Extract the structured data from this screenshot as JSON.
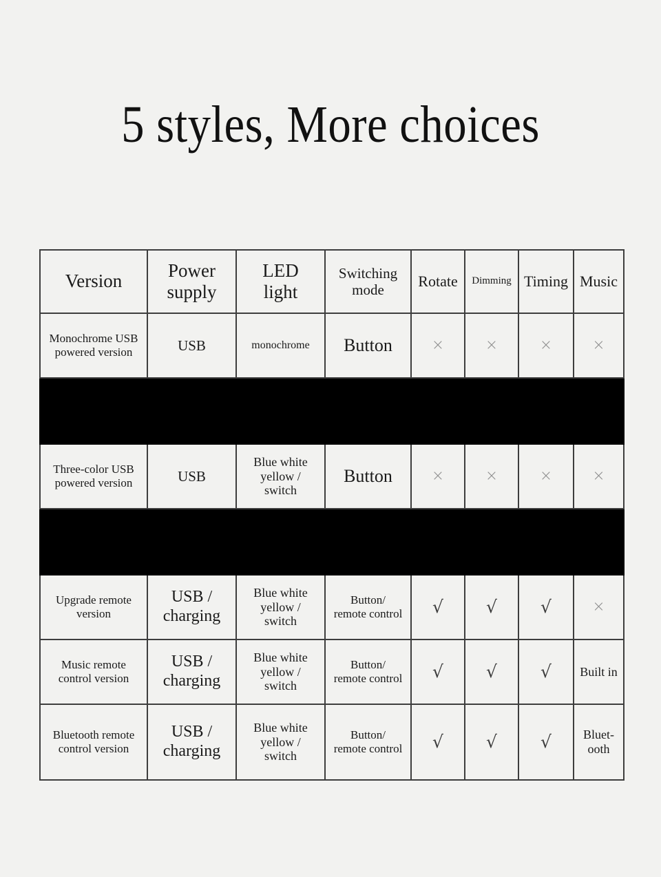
{
  "page": {
    "title": "5 styles, More choices",
    "background_color": "#f2f2f0",
    "text_color": "#1a1a1a",
    "border_color": "#3d3d3d",
    "band_color": "#000000",
    "x_mark_color": "#8e8e8e",
    "check_mark_color": "#3c3c3c"
  },
  "table": {
    "headers": [
      {
        "label": "Version"
      },
      {
        "label": "Power\nsupply"
      },
      {
        "label": "LED\nlight"
      },
      {
        "label": "Switching\nmode"
      },
      {
        "label": "Rotate"
      },
      {
        "label": "Dimming"
      },
      {
        "label": "Timing"
      },
      {
        "label": "Music"
      }
    ],
    "header_labels": {
      "version": "Version",
      "power_line1": "Power",
      "power_line2": "supply",
      "led_line1": "LED",
      "led_line2": "light",
      "switch_line1": "Switching",
      "switch_line2": "mode",
      "rotate": "Rotate",
      "dimming": "Dimming",
      "timing": "Timing",
      "music": "Music"
    },
    "rows": [
      {
        "type": "data",
        "version_line1": "Monochrome USB",
        "version_line2": "powered version",
        "power": "USB",
        "led_line1": "monochrome",
        "led_line2": "",
        "led_line3": "",
        "switch": "Button",
        "rotate": "×",
        "dimming": "×",
        "timing": "×",
        "music": "×"
      },
      {
        "type": "band"
      },
      {
        "type": "data",
        "version_line1": "Three-color USB",
        "version_line2": "powered version",
        "power": "USB",
        "led_line1": "Blue white",
        "led_line2": "yellow /",
        "led_line3": "switch",
        "switch": "Button",
        "rotate": "×",
        "dimming": "×",
        "timing": "×",
        "music": "×"
      },
      {
        "type": "band"
      },
      {
        "type": "data",
        "version_line1": "Upgrade remote",
        "version_line2": "version",
        "power_line1": "USB /",
        "power_line2": "charging",
        "led_line1": "Blue white",
        "led_line2": "yellow /",
        "led_line3": "switch",
        "switch_line1": "Button/",
        "switch_line2": "remote control",
        "rotate": "√",
        "dimming": "√",
        "timing": "√",
        "music": "×"
      },
      {
        "type": "data",
        "version_line1": "Music remote",
        "version_line2": "control version",
        "power_line1": "USB /",
        "power_line2": "charging",
        "led_line1": "Blue white",
        "led_line2": "yellow /",
        "led_line3": "switch",
        "switch_line1": "Button/",
        "switch_line2": "remote control",
        "rotate": "√",
        "dimming": "√",
        "timing": "√",
        "music": "Built in"
      },
      {
        "type": "data",
        "version_line1": "Bluetooth remote",
        "version_line2": "control version",
        "power_line1": "USB /",
        "power_line2": "charging",
        "led_line1": "Blue white",
        "led_line2": "yellow /",
        "led_line3": "switch",
        "switch_line1": "Button/",
        "switch_line2": "remote control",
        "rotate": "√",
        "dimming": "√",
        "timing": "√",
        "music_line1": "Bluet-",
        "music_line2": "ooth"
      }
    ]
  }
}
